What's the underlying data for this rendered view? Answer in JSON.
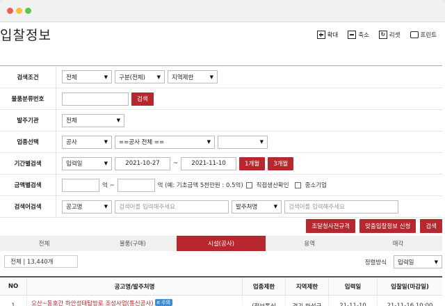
{
  "header": {
    "title": "입찰정보",
    "tools": [
      {
        "label": "확대",
        "icon": "zoom-in-icon"
      },
      {
        "label": "축소",
        "icon": "zoom-out-icon"
      },
      {
        "label": "리셋",
        "icon": "reset-icon"
      },
      {
        "label": "프린트",
        "icon": "print-icon"
      }
    ]
  },
  "form": {
    "search_cond": {
      "label": "검색조건",
      "type": "전체",
      "category": "구분(전체)",
      "region": "지역제한"
    },
    "item_code": {
      "label": "물품분류번호",
      "value": "",
      "button": "검색"
    },
    "agency": {
      "label": "발주기관",
      "value": "전체"
    },
    "industry": {
      "label": "업종선택",
      "type": "공사",
      "sub": "==공사 전체 ==",
      "extra": ""
    },
    "period": {
      "label": "기간별검색",
      "basis": "입력일",
      "from": "2021-10-27",
      "tilde": "~",
      "to": "2021-11-10",
      "btn1": "1개월",
      "btn2": "3개월"
    },
    "amount": {
      "label": "금액별검색",
      "unit1": "억 ~",
      "unit2": "억 (예: 기초금액 5천만원 : 0.5억)",
      "check1": "직접생산확인",
      "check2": "중소기업"
    },
    "keyword": {
      "label": "검색어검색",
      "field1": "공고명",
      "placeholder1": "검색어를 입력해주세요",
      "field2": "발주처명",
      "placeholder2": "검색어를 입력해주세요"
    }
  },
  "actions": {
    "btn1": "조달청사전규격",
    "btn2": "맞춤입찰정보 신청",
    "btn3": "검색"
  },
  "tabs": [
    {
      "label": "전체",
      "active": false
    },
    {
      "label": "물품(구매)",
      "active": false
    },
    {
      "label": "시설(공사)",
      "active": true
    },
    {
      "label": "용역",
      "active": false
    },
    {
      "label": "매각",
      "active": false
    }
  ],
  "list": {
    "count": "전체 | 13,440개",
    "sort_label": "정렬방식",
    "sort_value": "입력일",
    "columns": [
      "NO",
      "공고명/발주처명",
      "업종제한",
      "지역제한",
      "입력일",
      "입찰일(마감일)"
    ],
    "rows": [
      {
        "no": "1",
        "title": "오산~동호간 하안성태탑방로 조성사업(통신공사)",
        "badge": "e 수의",
        "industry": "(정보통신",
        "region": "경기 화성군",
        "input_date": "21-11-10",
        "bid_date": "21-11-16 10:00"
      }
    ]
  },
  "colors": {
    "accent": "#b6282e",
    "badge": "#3d8ed6"
  }
}
